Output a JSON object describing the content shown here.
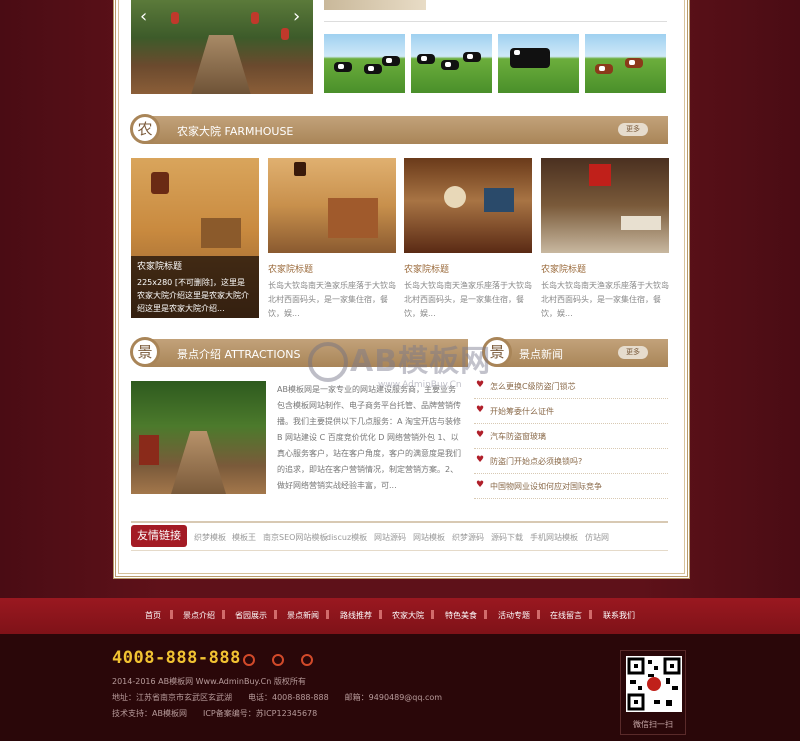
{
  "farmhouse": {
    "badge": "农",
    "title": "农家大院 FARMHOUSE",
    "more": "更多",
    "feature": {
      "title": "农家院标题",
      "desc": "225x280 [不可删除]，这里是农家大院介绍这里是农家大院介绍这里是农家大院介绍..."
    },
    "cards": [
      {
        "title": "农家院标题",
        "desc": "长岛大钦岛南天渔家乐座落于大钦岛北村西面码头，是一家集住宿，餐饮，娱..."
      },
      {
        "title": "农家院标题",
        "desc": "长岛大钦岛南天渔家乐座落于大钦岛北村西面码头，是一家集住宿，餐饮，娱..."
      },
      {
        "title": "农家院标题",
        "desc": "长岛大钦岛南天渔家乐座落于大钦岛北村西面码头，是一家集住宿，餐饮，娱..."
      }
    ]
  },
  "attractions": {
    "badge": "景",
    "title": "景点介绍 ATTRACTIONS",
    "text": "AB模板网是一家专业的网站建设服务商，主要业务包含模板网站制作、电子商务平台托管、品牌营销传播。我们主要提供以下几点服务：A 淘宝开店与装修 B 网站建设 C 百度竞价优化 D 网络营销外包 1、以真心服务客户，站在客户角度，客户的满意度是我们的追求，即站在客户营销情况，制定营销方案。2、做好网络营销实战经验丰富，可..."
  },
  "news": {
    "badge": "景",
    "title": "景点新闻",
    "more": "更多",
    "items": [
      {
        "title": "怎么更换C级防盗门锁芯"
      },
      {
        "title": "开始筹委什么证件"
      },
      {
        "title": "汽车防盗窗玻璃"
      },
      {
        "title": "防盗门开始点必须换锁吗?"
      },
      {
        "title": "中国物网业设如何应对国际竞争"
      }
    ]
  },
  "links": {
    "label": "友情链接",
    "items": [
      "织梦模板",
      "模板王",
      "南京SEO网站模板",
      "discuz模板",
      "网站源码",
      "网站模板",
      "织梦源码",
      "源码下载",
      "手机网站模板",
      "仿站网"
    ]
  },
  "nav": {
    "items": [
      "首页",
      "景点介绍",
      "省园展示",
      "景点新闻",
      "路线推荐",
      "农家大院",
      "特色美食",
      "活动专题",
      "在线留言",
      "联系我们"
    ]
  },
  "footer": {
    "phone": "4008-888-888",
    "copyright": "2014-2016 AB模板网 Www.AdminBuy.Cn 版权所有",
    "address": "地址：江苏省南京市玄武区玄武湖　　电话：4008-888-888　　邮箱：9490489@qq.com",
    "support": "技术支持：AB模板网　　ICP备案编号：苏ICP12345678",
    "qr_caption": "微信扫一扫"
  },
  "watermark": {
    "brand": "AB模板网",
    "url": "www.AdminBuy.Cn"
  }
}
